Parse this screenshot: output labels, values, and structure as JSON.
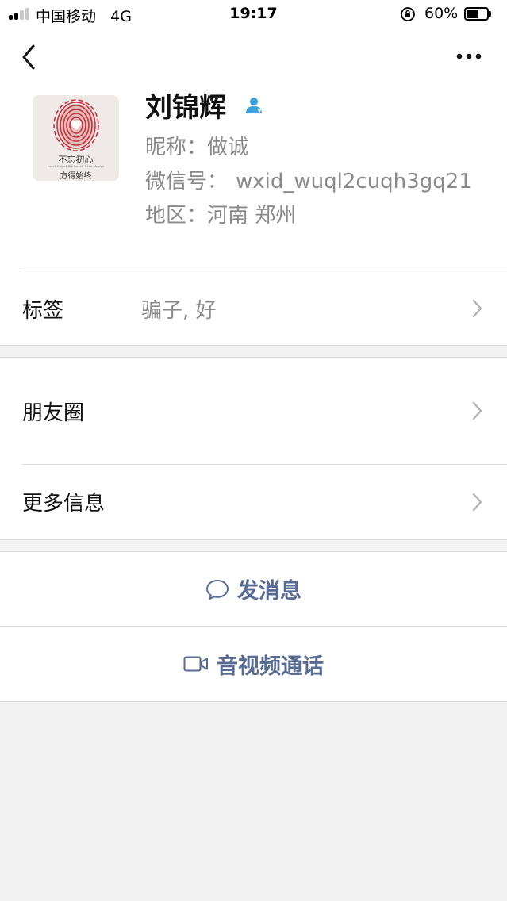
{
  "status_bar": {
    "carrier": "中国移动",
    "network": "4G",
    "time": "19:17",
    "battery_percent": "60%",
    "battery_level": 0.6,
    "signal_bars_filled": 2,
    "signal_bars_total": 4
  },
  "nav": {
    "back_icon": "chevron-left-icon",
    "more_icon": "ellipsis-icon"
  },
  "profile": {
    "name": "刘锦辉",
    "nickname_label": "昵称：",
    "nickname": "做诚",
    "wechat_id_label": "微信号：",
    "wechat_id": "wxid_wuql2cuqh3gq21",
    "region_label": "地区：",
    "region": "河南 郑州",
    "avatar": {
      "caption_main": "不忘初心",
      "caption_small": "Don't forget the heart, have always",
      "caption_bottom": "方得始终",
      "accent_color": "#c8323c"
    }
  },
  "rows": {
    "tags_label": "标签",
    "tags_value": "骗子, 好",
    "moments_label": "朋友圈",
    "more_info_label": "更多信息"
  },
  "actions": {
    "message_label": "发消息",
    "call_label": "音视频通话",
    "link_color": "#576b95"
  }
}
